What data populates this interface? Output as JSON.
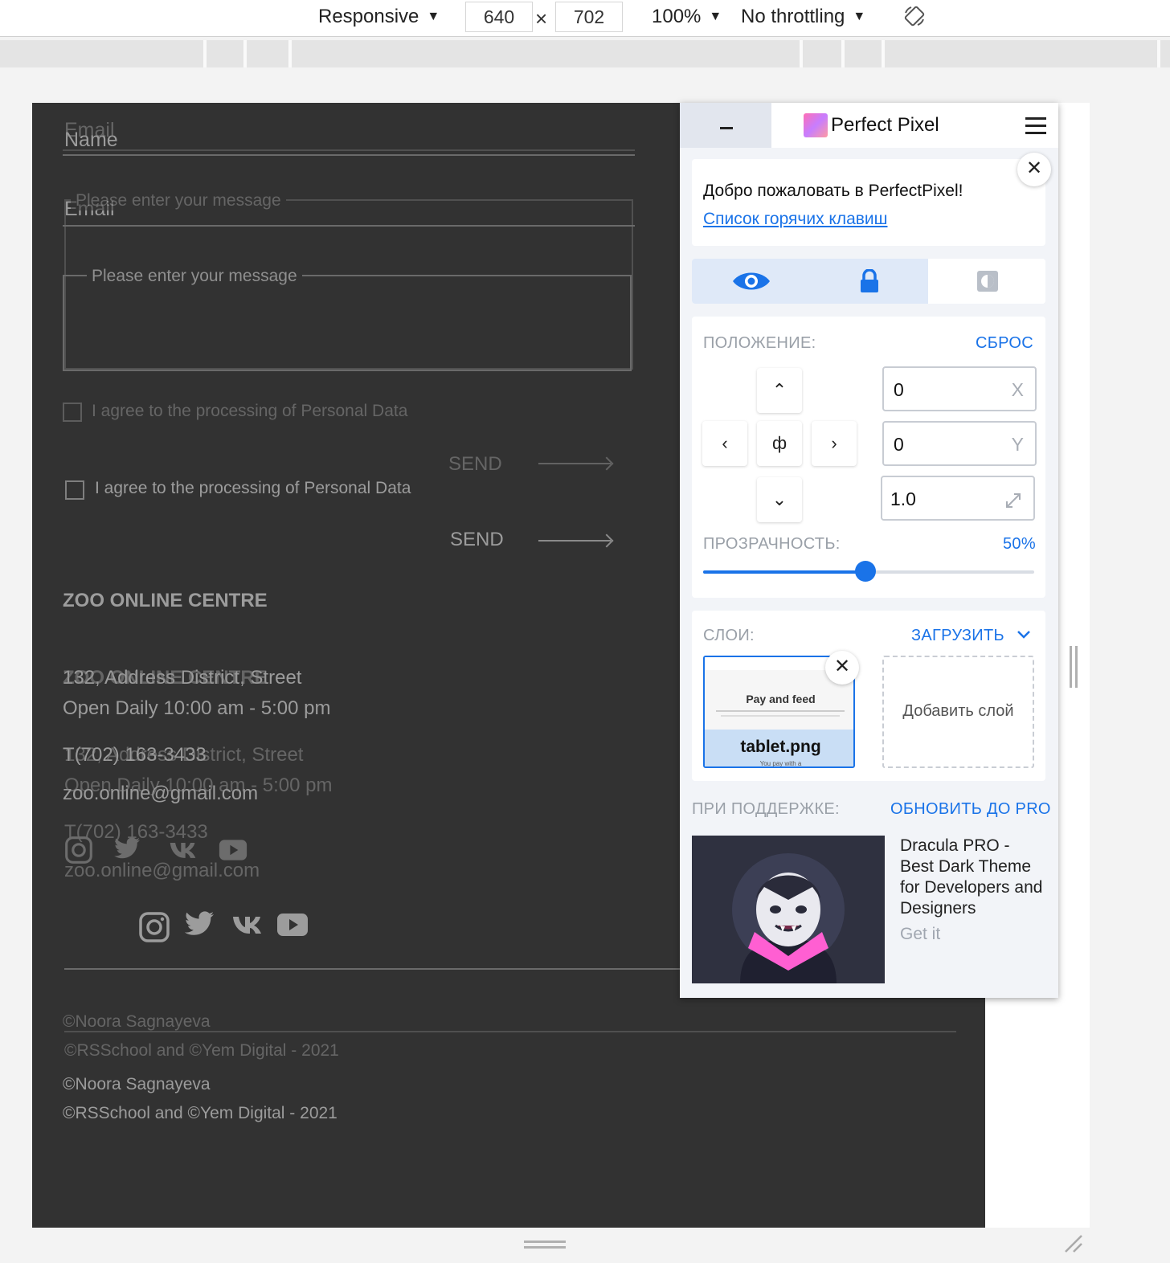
{
  "devtools": {
    "device": "Responsive",
    "width": "640",
    "height": "702",
    "times": "×",
    "zoom": "100%",
    "throttling": "No throttling",
    "caret": "▼"
  },
  "page": {
    "form_tablet": {
      "name": "Name",
      "email": "Email",
      "message_placeholder": "Please enter your message",
      "consent": "I agree to the processing of Personal Data",
      "send": "SEND"
    },
    "form_overlay": {
      "email": "Email",
      "message_placeholder": "Please enter your message",
      "consent": "I agree to the processing of Personal Data",
      "send": "SEND"
    },
    "footer_tablet": {
      "title": "ZOO ONLINE CENTRE",
      "address": "132, Address District, Street",
      "hours": "Open Daily 10:00 am - 5:00 pm",
      "phone": "T(702) 163-3433",
      "email": "zoo.online@gmail.com",
      "copyright1": "©Noora Sagnayeva",
      "copyright2": "©RSSchool and ©Yem Digital - 2021"
    },
    "footer_overlay": {
      "title": "ZOO ONLINE CENTRE",
      "address": "132, Address District, Street",
      "hours": "Open Daily 10:00 am - 5:00 pm",
      "phone": "T(702) 163-3433",
      "email": "zoo.online@gmail.com",
      "copyright1": "©Noora Sagnayeva",
      "copyright2": "©RSSchool and ©Yem Digital - 2021"
    },
    "social_icons": [
      "instagram-icon",
      "twitter-icon",
      "vk-icon",
      "youtube-icon"
    ]
  },
  "perfectpixel": {
    "title": "Perfect Pixel",
    "welcome": "Добро пожаловать в PerfectPixel!",
    "hotkeys_link": "Список горячих клавиш",
    "position_label": "ПОЛОЖЕНИЕ:",
    "reset": "СБРОС",
    "x_value": "0",
    "x_unit": "X",
    "y_value": "0",
    "y_unit": "Y",
    "scale_value": "1.0",
    "opacity_label": "ПРОЗРАЧНОСТЬ:",
    "opacity_value": "50%",
    "opacity_fraction": 0.49,
    "layers_label": "СЛОИ:",
    "upload": "ЗАГРУЗИТЬ",
    "layer_name": "tablet.png",
    "layer_thumb_heading": "Pay and feed",
    "layer_thumb_caption": "You pay with a",
    "add_layer": "Добавить слой",
    "sponsor_label": "ПРИ ПОДДЕРЖКЕ:",
    "upgrade": "ОБНОВИТЬ ДО PRO",
    "ad_text": "Dracula PRO - Best Dark Theme for Developers and Designers",
    "ad_cta": "Get it",
    "accent_color": "#1a73e8"
  }
}
